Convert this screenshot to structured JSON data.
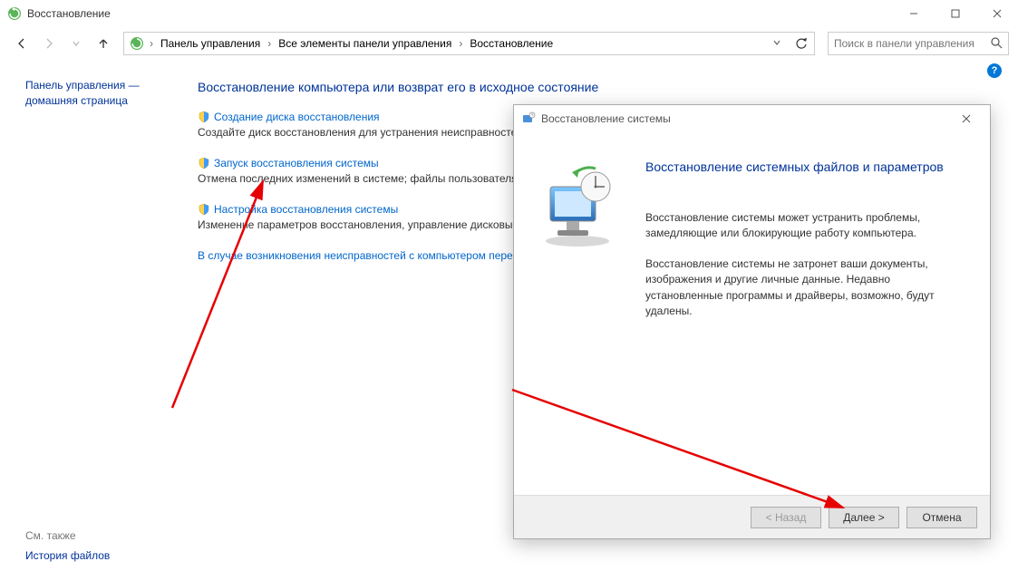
{
  "window": {
    "title": "Восстановление",
    "minimize": "—",
    "maximize": "☐",
    "close": "✕"
  },
  "nav": {
    "breadcrumb": [
      "Панель управления",
      "Все элементы панели управления",
      "Восстановление"
    ],
    "search_placeholder": "Поиск в панели управления"
  },
  "sidebar": {
    "home_link": "Панель управления — домашняя страница",
    "see_also_label": "См. также",
    "file_history_link": "История файлов"
  },
  "content": {
    "heading": "Восстановление компьютера или возврат его в исходное состояние",
    "options": [
      {
        "title": "Создание диска восстановления",
        "desc": "Создайте диск восстановления для устранения неисправностей, когда компьютер не запускается."
      },
      {
        "title": "Запуск восстановления системы",
        "desc": "Отмена последних изменений в системе; файлы пользователя, например, документы, изображения и музыка, остаются без изменений."
      },
      {
        "title": "Настройка восстановления системы",
        "desc": "Изменение параметров восстановления, управление дисковым пространством и создание или удаление точек восстановления."
      }
    ],
    "below_link": "В случае возникновения неисправностей с компьютером перейдите к его параметрам и попробуйте изменить их."
  },
  "dialog": {
    "title": "Восстановление системы",
    "heading": "Восстановление системных файлов и параметров",
    "para1": "Восстановление системы может устранить проблемы, замедляющие или блокирующие работу компьютера.",
    "para2": "Восстановление системы не затронет ваши документы, изображения и другие личные данные. Недавно установленные программы и драйверы, возможно, будут удалены.",
    "back": "< Назад",
    "next": "Далее >",
    "cancel": "Отмена"
  }
}
